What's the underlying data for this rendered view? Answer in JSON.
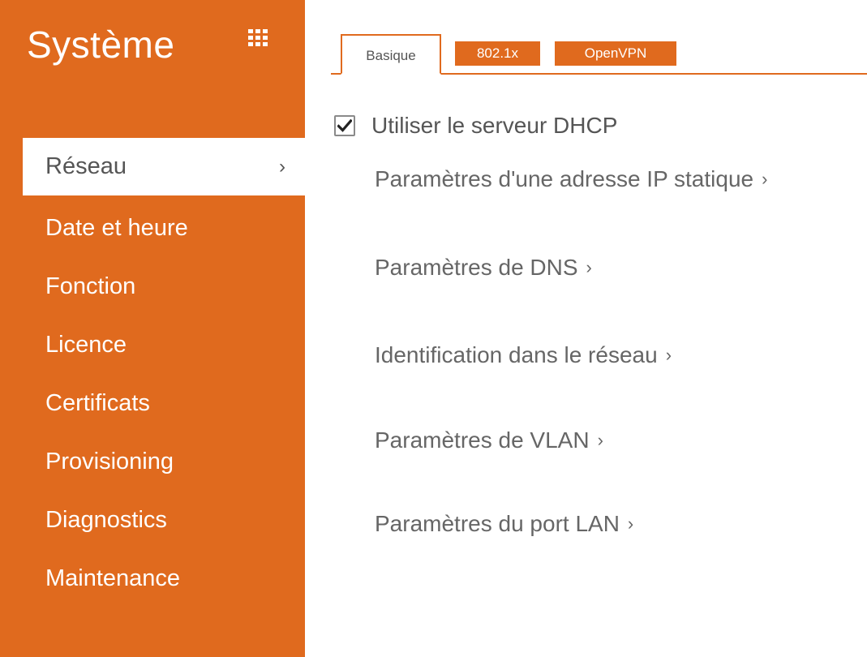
{
  "sidebar": {
    "title": "Système",
    "grid_icon": "apps-grid-icon",
    "items": [
      {
        "label": "Réseau",
        "active": true,
        "chevron": "›"
      },
      {
        "label": "Date et heure"
      },
      {
        "label": "Fonction"
      },
      {
        "label": "Licence"
      },
      {
        "label": "Certificats"
      },
      {
        "label": "Provisioning"
      },
      {
        "label": "Diagnostics"
      },
      {
        "label": "Maintenance"
      }
    ]
  },
  "tabs": [
    {
      "label": "Basique",
      "active": true
    },
    {
      "label": "802.1x"
    },
    {
      "label": "OpenVPN"
    }
  ],
  "dhcp": {
    "label": "Utiliser le serveur DHCP",
    "checked": true
  },
  "links": [
    {
      "label": "Paramètres d'une adresse IP statique",
      "chevron": "›"
    },
    {
      "label": "Paramètres de DNS",
      "chevron": "›"
    },
    {
      "label": "Identification dans le réseau",
      "chevron": "›"
    },
    {
      "label": "Paramètres de VLAN",
      "chevron": "›"
    },
    {
      "label": "Paramètres du port LAN",
      "chevron": "›"
    }
  ],
  "colors": {
    "accent": "#e06a1e",
    "text": "#555555",
    "background": "#ffffff"
  }
}
